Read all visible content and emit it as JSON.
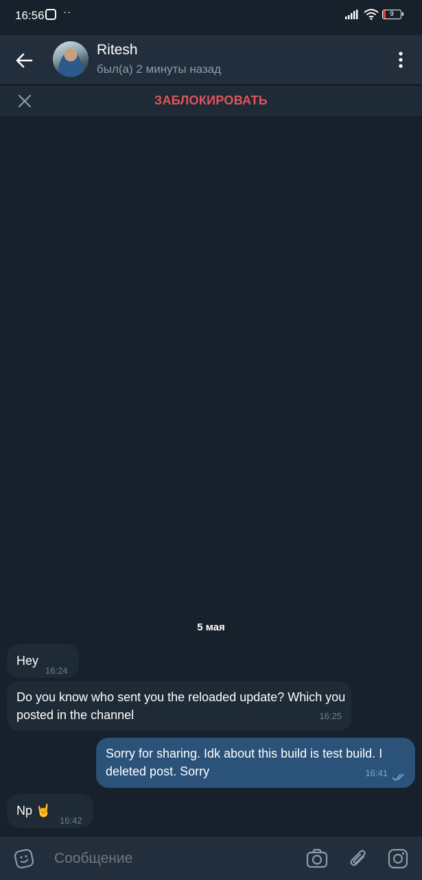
{
  "status_bar": {
    "time": "16:56",
    "dots": "··",
    "battery": "9"
  },
  "header": {
    "name": "Ritesh",
    "last_seen": "был(а) 2 минуты назад"
  },
  "block_bar": {
    "label": "ЗАБЛОКИРОВАТЬ"
  },
  "chat": {
    "date": "5 мая",
    "messages": [
      {
        "direction": "in",
        "text": "Hey",
        "time": "16:24"
      },
      {
        "direction": "in",
        "text": "Do you know who sent you the reloaded update? Which you posted in the channel",
        "time": "16:25"
      },
      {
        "direction": "out",
        "text": "Sorry for sharing. Idk about this build is test build. I deleted post. Sorry",
        "time": "16:41",
        "read": true
      },
      {
        "direction": "in",
        "text": "Np 🤘",
        "time": "16:42"
      }
    ]
  },
  "composer": {
    "placeholder": "Сообщение"
  },
  "colors": {
    "background": "#17212b",
    "header": "#232e3c",
    "incoming_bubble": "#1e2a36",
    "outgoing_bubble": "#2b5278",
    "block_red": "#e0545b"
  }
}
